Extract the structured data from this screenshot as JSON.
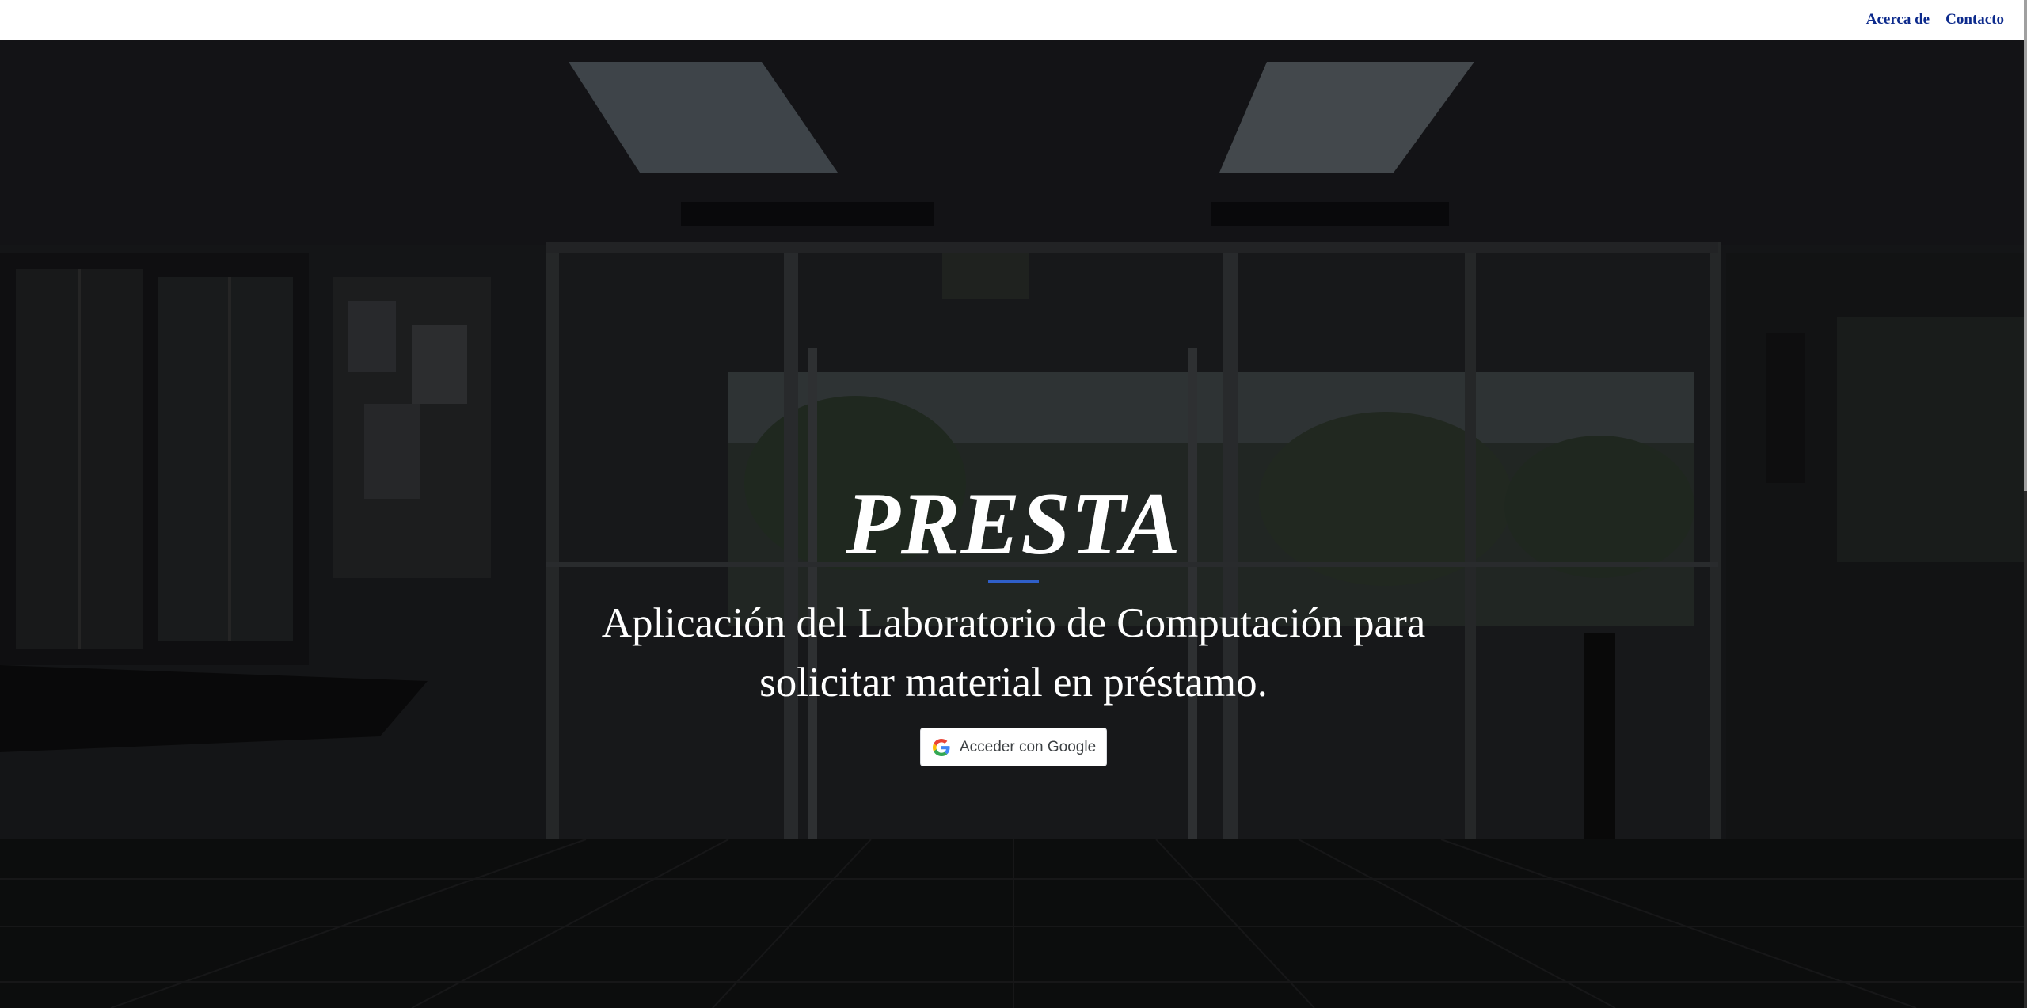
{
  "nav": {
    "about_label": "Acerca de",
    "contact_label": "Contacto"
  },
  "hero": {
    "title": "PRESTA",
    "subtitle": "Aplicación del Laboratorio de Computación para solicitar material en préstamo.",
    "signin_label": "Acceder con Google",
    "signin_icon": "google-g-icon"
  },
  "colors": {
    "nav_link": "#0c2a8c",
    "divider_accent": "#2f5fc9",
    "topbar_bg": "#ffffff"
  }
}
